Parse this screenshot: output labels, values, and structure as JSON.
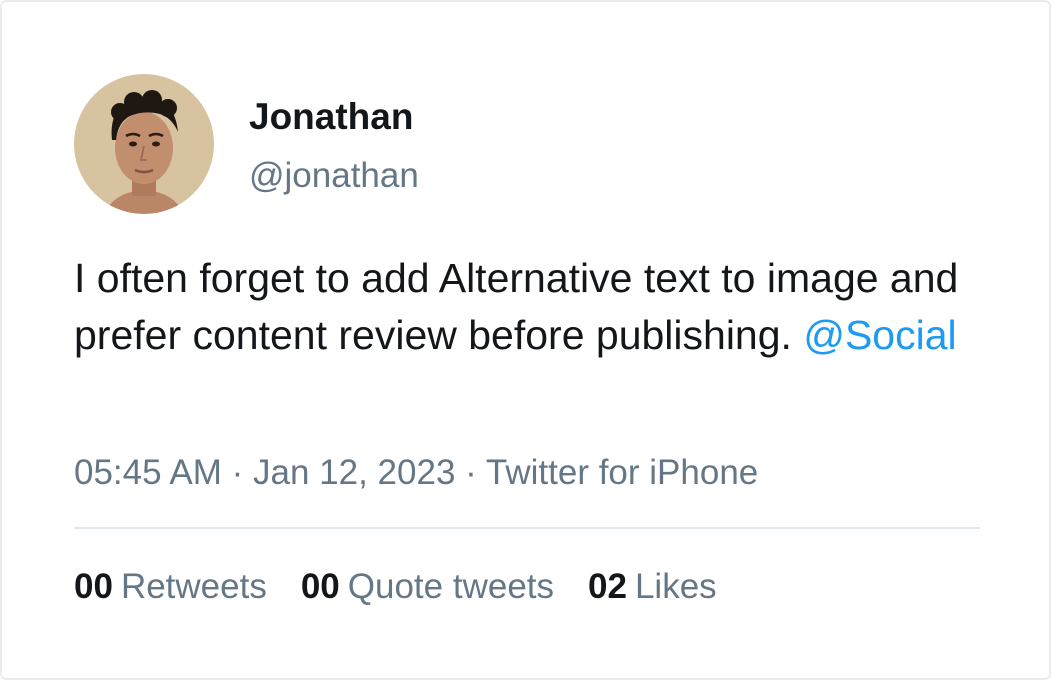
{
  "tweet": {
    "author": {
      "display_name": "Jonathan",
      "handle": "@jonathan"
    },
    "text": "I often forget to add Alternative text to image and prefer content review before publishing.",
    "mention": "@Social",
    "time": "05:45 AM",
    "date": "Jan 12, 2023",
    "source": "Twitter for iPhone",
    "separator": "·"
  },
  "stats": {
    "retweets": {
      "count": "00",
      "label": "Retweets"
    },
    "quotes": {
      "count": "00",
      "label": "Quote tweets"
    },
    "likes": {
      "count": "02",
      "label": "Likes"
    }
  },
  "colors": {
    "text_primary": "#14171a",
    "text_secondary": "#657786",
    "link": "#1d9bf0",
    "divider": "#e1e8ed"
  }
}
